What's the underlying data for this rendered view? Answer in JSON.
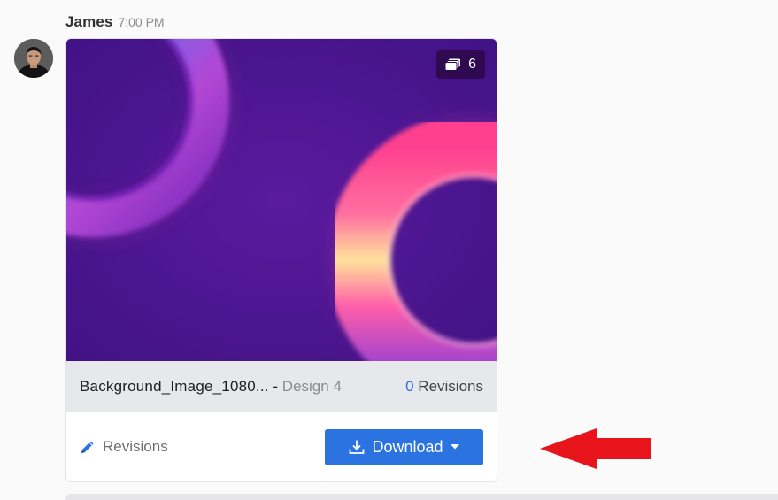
{
  "message": {
    "sender": "James",
    "time": "7:00 PM",
    "avatar_icon": "user-avatar"
  },
  "attachment": {
    "image_count": "6",
    "image_count_icon": "images-stack-icon",
    "file_name": "Background_Image_1080...",
    "separator": " - ",
    "design_label": "Design 4",
    "revisions_count": "0",
    "revisions_count_label": " Revisions",
    "revisions_link_label": "Revisions",
    "download_label": "Download"
  },
  "colors": {
    "accent": "#2b73e1",
    "annotation_arrow": "#e8141b",
    "preview_bg": "#4a138c"
  }
}
